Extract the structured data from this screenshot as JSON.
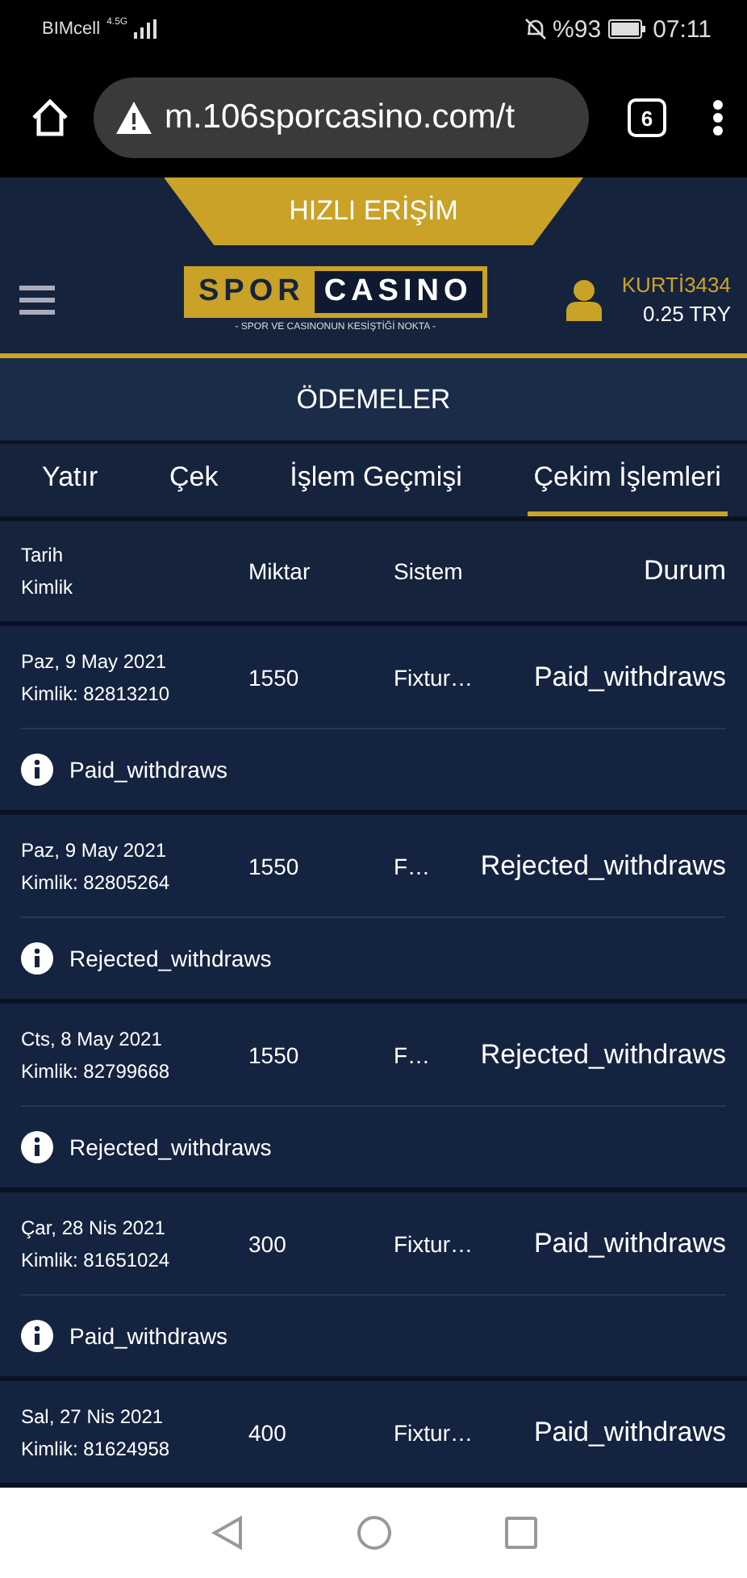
{
  "status_bar": {
    "carrier": "BIMcell",
    "network": "4.5G",
    "battery": "%93",
    "time": "07:11"
  },
  "browser": {
    "url": "m.106sporcasino.com/t",
    "tab_count": "6"
  },
  "quick_access": "HIZLI ERİŞİM",
  "header": {
    "logo_left": "SPOR",
    "logo_right": "CASINO",
    "tagline": "- SPOR VE CASINONUN KESİŞTİĞİ NOKTA -",
    "username": "KURTİ3434",
    "balance": "0.25 TRY"
  },
  "page_title": "ÖDEMELER",
  "tabs": [
    {
      "label": "Yatır",
      "selected": false
    },
    {
      "label": "Çek",
      "selected": false
    },
    {
      "label": "İşlem Geçmişi",
      "selected": false
    },
    {
      "label": "Çekim İşlemleri",
      "selected": true
    }
  ],
  "table": {
    "columns": {
      "date": "Tarih",
      "id": "Kimlik",
      "amount": "Miktar",
      "system": "Sistem",
      "status": "Durum"
    },
    "rows": [
      {
        "date": "Paz, 9 May 2021",
        "id": "Kimlik: 82813210",
        "amount": "1550",
        "system": "Fixtur…",
        "status": "Paid_withdraws",
        "info": "Paid_withdraws"
      },
      {
        "date": "Paz, 9 May 2021",
        "id": "Kimlik: 82805264",
        "amount": "1550",
        "system": "F…",
        "status": "Rejected_withdraws",
        "info": "Rejected_withdraws"
      },
      {
        "date": "Cts, 8 May 2021",
        "id": "Kimlik: 82799668",
        "amount": "1550",
        "system": "F…",
        "status": "Rejected_withdraws",
        "info": "Rejected_withdraws"
      },
      {
        "date": "Çar, 28 Nis 2021",
        "id": "Kimlik: 81651024",
        "amount": "300",
        "system": "Fixtur…",
        "status": "Paid_withdraws",
        "info": "Paid_withdraws"
      },
      {
        "date": "Sal, 27 Nis 2021",
        "id": "Kimlik: 81624958",
        "amount": "400",
        "system": "Fixtur…",
        "status": "Paid_withdraws"
      }
    ]
  }
}
